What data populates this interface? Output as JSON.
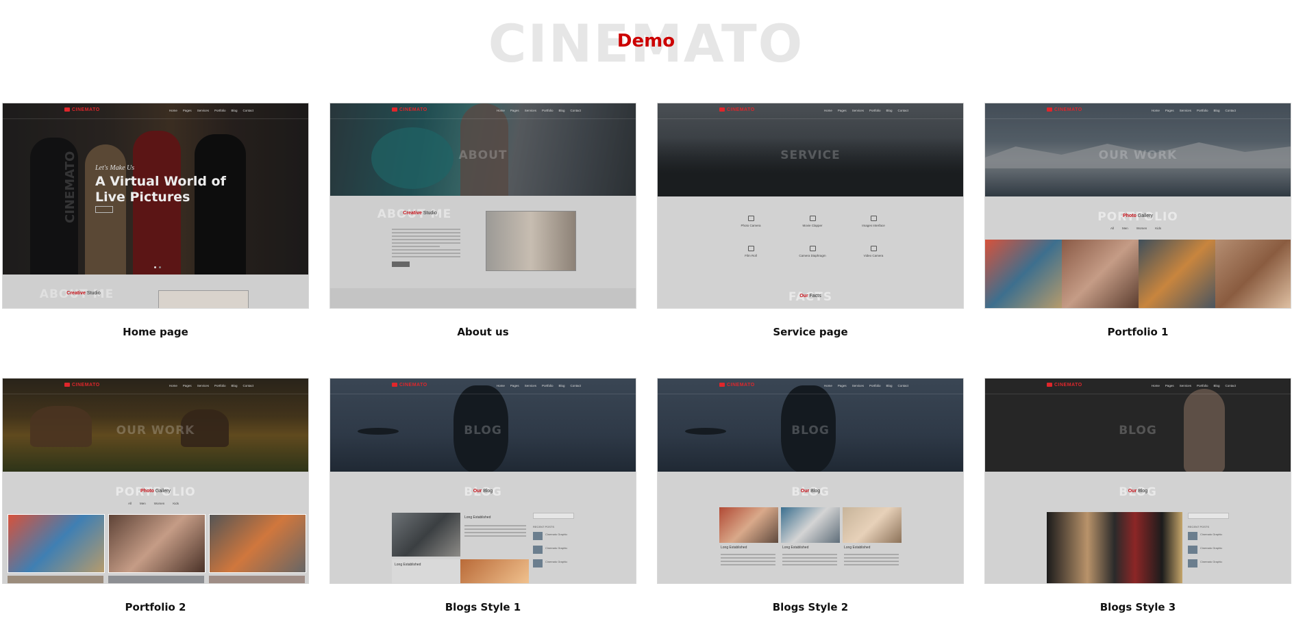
{
  "header": {
    "watermark": "CINEMATO",
    "title": "Demo"
  },
  "mini": {
    "logo": "CINEMATO",
    "menu": [
      "Home",
      "Pages",
      "Services",
      "Portfolio",
      "Blog",
      "Contact"
    ],
    "creative_studio": "Creative Studio",
    "photo_gallery": "Photo Gallery",
    "our_blog": "Our Blog",
    "our_facts": "Our Facts",
    "lets_make_us": "Let's Make Us",
    "hero_line1": "A Virtual World of",
    "hero_line2": "Live Pictures",
    "services": [
      "Photo Camera",
      "Movie Clapper",
      "Images Interface",
      "Film Roll",
      "Camera Diaphragm",
      "Video Camera"
    ],
    "filters": [
      "All",
      "Men",
      "Women",
      "Kids"
    ],
    "long_established": "Long Established",
    "recent_posts": "RECENT POSTS",
    "post_author": "Cinemato Graphic"
  },
  "demos": [
    {
      "caption": "Home page",
      "hero_word": "CINEMATO",
      "heading": "ABOUT ME"
    },
    {
      "caption": "About us",
      "hero_word": "ABOUT",
      "heading": "ABOUT ME"
    },
    {
      "caption": "Service page",
      "hero_word": "SERVICE",
      "heading": "FACTS"
    },
    {
      "caption": "Portfolio 1",
      "hero_word": "OUR WORK",
      "heading": "PORTFOLIO"
    },
    {
      "caption": "Portfolio 2",
      "hero_word": "OUR WORK",
      "heading": "PORTFOLIO"
    },
    {
      "caption": "Blogs Style 1",
      "hero_word": "BLOG",
      "heading": "BLOG"
    },
    {
      "caption": "Blogs Style 2",
      "hero_word": "BLOG",
      "heading": "BLOG"
    },
    {
      "caption": "Blogs Style 3",
      "hero_word": "BLOG",
      "heading": "BLOG"
    }
  ]
}
